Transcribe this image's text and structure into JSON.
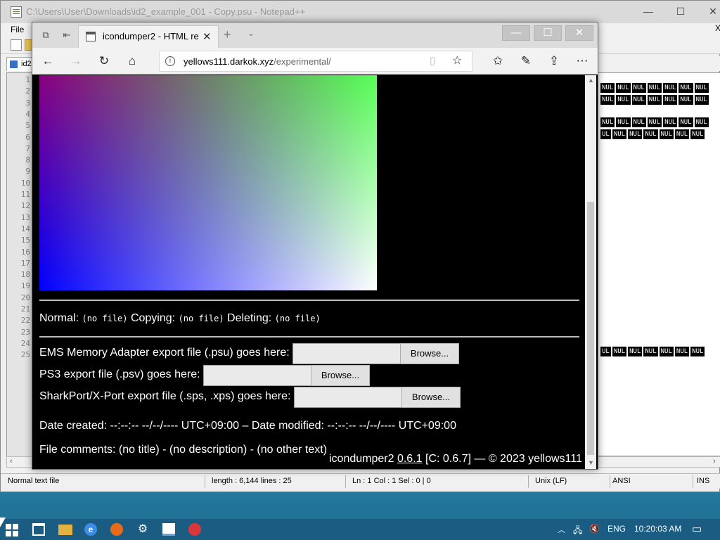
{
  "notepad": {
    "title": "C:\\Users\\User\\Downloads\\id2_example_001 - Copy.psu - Notepad++",
    "menu_file": "File",
    "menu_right": "X",
    "tab_label": "id2",
    "line_numbers": [
      "1",
      "2",
      "3",
      "4",
      "5",
      "6",
      "7",
      "8",
      "9",
      "10",
      "11",
      "12",
      "13",
      "14",
      "15",
      "16",
      "17",
      "18",
      "19",
      "20",
      "21",
      "22",
      "23",
      "24",
      "25"
    ],
    "nul_token": "NUL",
    "nul_partial": "UL",
    "status": {
      "file_type": "Normal text file",
      "length_lines": "length : 6,144    lines : 25",
      "position": "Ln : 1    Col : 1    Sel : 0 | 0",
      "eol": "Unix (LF)",
      "encoding": "ANSI",
      "mode": "INS"
    }
  },
  "browser": {
    "tab_title": "icondumper2 - HTML re",
    "url_host": "yellows111.darkok.xyz",
    "url_path": "/experimental/"
  },
  "page": {
    "normal_label": "Normal:",
    "copying_label": "Copying:",
    "deleting_label": "Deleting:",
    "no_file": "(no file)",
    "ems_label": "EMS Memory Adapter export file (.psu) goes here:",
    "ps3_label": "PS3 export file (.psv) goes here:",
    "sharkport_label": "SharkPort/X-Port export file (.sps, .xps) goes here:",
    "browse_label": "Browse...",
    "dates": "Date created: --:--:-- --/--/---- UTC+09:00 – Date modified: --:--:-- --/--/---- UTC+09:00",
    "comments": "File comments: (no title) - (no description) - (no other text)",
    "footer_name": "icondumper2",
    "footer_version": "0.6.1",
    "footer_rest": "[C: 0.6.7] — © 2023 yellows111"
  },
  "taskbar": {
    "language": "ENG",
    "time": "10:20:03 AM"
  },
  "colors": {
    "taskbar": "#1b5c83",
    "page_background": "#000000",
    "nul_background": "#000000"
  }
}
